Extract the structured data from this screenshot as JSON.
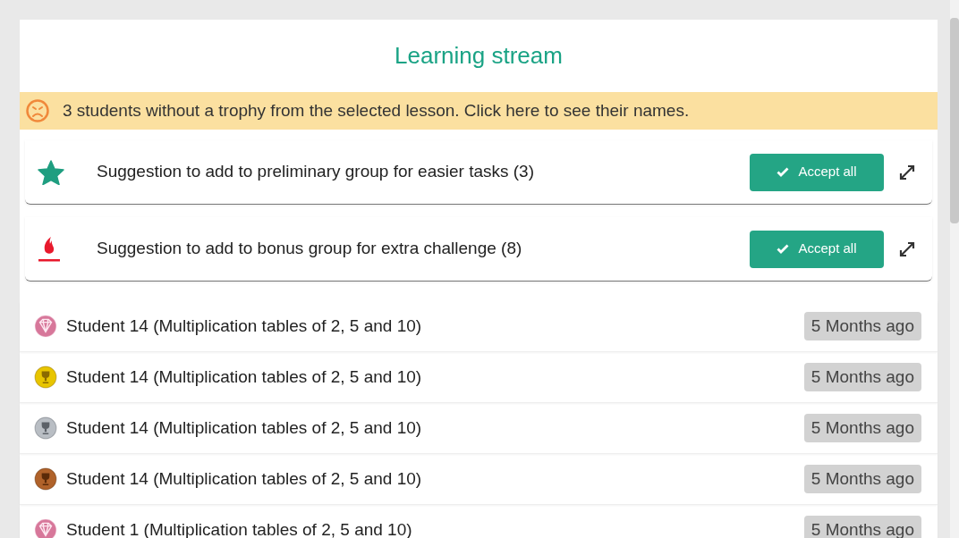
{
  "title": "Learning stream",
  "alert": {
    "text": "3 students without a trophy from the selected lesson. Click here to see their names."
  },
  "suggestions": [
    {
      "kind": "star",
      "text": "Suggestion to add to preliminary group for easier tasks (3)",
      "button": "Accept all"
    },
    {
      "kind": "flame",
      "text": "Suggestion to add to bonus group for extra challenge (8)",
      "button": "Accept all"
    }
  ],
  "stream": [
    {
      "kind": "diamond",
      "text": "Student 14 (Multiplication tables of 2, 5 and 10)",
      "time": "5 Months ago"
    },
    {
      "kind": "gold",
      "text": "Student 14 (Multiplication tables of 2, 5 and 10)",
      "time": "5 Months ago"
    },
    {
      "kind": "silver",
      "text": "Student 14 (Multiplication tables of 2, 5 and 10)",
      "time": "5 Months ago"
    },
    {
      "kind": "bronze",
      "text": "Student 14 (Multiplication tables of 2, 5 and 10)",
      "time": "5 Months ago"
    },
    {
      "kind": "diamond",
      "text": "Student 1 (Multiplication tables of 2, 5 and 10)",
      "time": "5 Months ago"
    }
  ]
}
